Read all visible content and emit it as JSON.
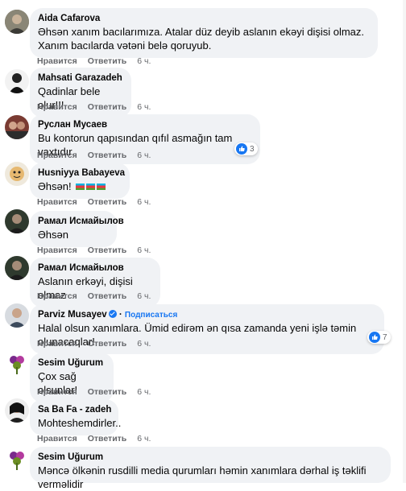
{
  "comments": [
    {
      "name": "Aida Cafarova",
      "text": "Əhsən xanım bacılarımıza. Atalar düz deyib aslanın ekəyi dişisi olmaz. Xanım bacılarda vətəni belə qoruyub.",
      "like": "Нравится",
      "reply": "Ответить",
      "time": "6 ч."
    },
    {
      "name": "Mahsati Garazadeh",
      "text": "Qadinlar bele olur!!!",
      "like": "Нравится",
      "reply": "Ответить",
      "time": "6 ч."
    },
    {
      "name": "Руслан Мусаев",
      "text": "Bu kontorun qapısından qıfıl asmağın tam vaxtıdır.",
      "like": "Нравится",
      "reply": "Ответить",
      "time": "6 ч.",
      "reactions": "3"
    },
    {
      "name": "Husniyya Babayeva",
      "text": "Əhsən!",
      "like": "Нравится",
      "reply": "Ответить",
      "time": "6 ч."
    },
    {
      "name": "Рамал Исмайылов",
      "text": "Əhsən",
      "like": "Нравится",
      "reply": "Ответить",
      "time": "6 ч."
    },
    {
      "name": "Рамал Исмайылов",
      "text": "Aslanın erkəyi, dişisi olmaz",
      "like": "Нравится",
      "reply": "Ответить",
      "time": "6 ч."
    },
    {
      "name": "Parviz Musayev",
      "subscribe": "Подписаться",
      "text": "Halal olsun xanımlara. Ümid edirəm ən qısa zamanda yeni işlə təmin olunacaqlar!",
      "like": "Нравится",
      "reply": "Ответить",
      "time": "6 ч.",
      "reactions": "7"
    },
    {
      "name": "Sesim Uğurum",
      "text": "Çox sağ olsunlar!",
      "like": "Нравится",
      "reply": "Ответить",
      "time": "6 ч."
    },
    {
      "name": "Sa Ba Fa - zadeh",
      "text": "Mohteshemdirler..",
      "like": "Нравится",
      "reply": "Ответить",
      "time": "6 ч."
    },
    {
      "name": "Sesim Uğurum",
      "text": "Məncə ölkənin rusdilli media qurumları həmin xanımlara dərhal iş təklifi verməlidir"
    }
  ],
  "colors": {
    "bubble": "#f0f2f5",
    "link": "#1877f2",
    "meta": "#65676b"
  }
}
